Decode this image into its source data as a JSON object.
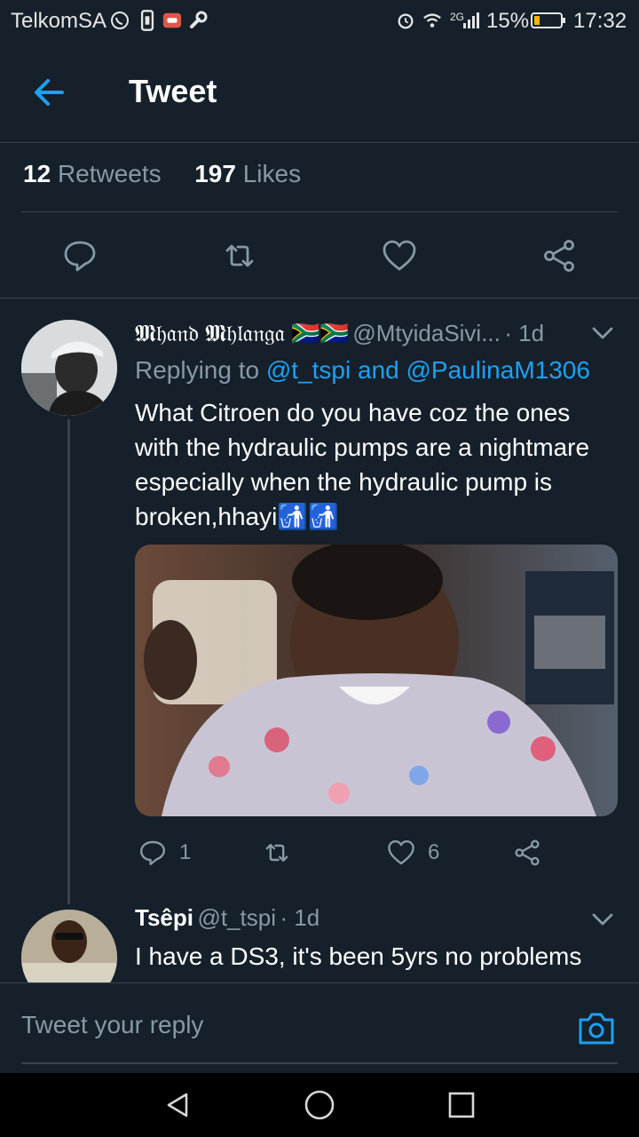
{
  "status_bar": {
    "carrier": "TelkomSA",
    "network": "2G",
    "battery": "15%",
    "time": "17:32"
  },
  "header": {
    "title": "Tweet",
    "back_icon": "back-arrow-icon"
  },
  "stats": {
    "retweets_count": "12",
    "retweets_label": "Retweets",
    "likes_count": "197",
    "likes_label": "Likes"
  },
  "actions": [
    "reply-icon",
    "retweet-icon",
    "like-icon",
    "share-icon"
  ],
  "reply1": {
    "display_name": "𝕸𝔥𝔞𝔫𝔡 𝕸𝔥𝔩𝔞𝔫𝔤𝔞 🇿🇦🇿🇦",
    "handle": "@MtyidaSivi...",
    "time": "· 1d",
    "replying_prefix": "Replying to",
    "replying_users": "@t_tspi and @PaulinaM1306",
    "text": "What Citroen do you have coz the ones with the hydraulic pumps are a nightmare especially when the hydraulic pump is broken,hhayi🚮🚮",
    "reply_count": "1",
    "like_count": "6"
  },
  "reply2": {
    "display_name": "Tsêpi",
    "handle": "@t_tspi",
    "time": "· 1d",
    "text": "I have a DS3, it's been 5yrs no problems"
  },
  "reply_box": {
    "placeholder": "Tweet your reply"
  },
  "colors": {
    "background": "#15202b",
    "accent": "#1da1f2",
    "muted": "#8899a6",
    "divider": "#38444d"
  }
}
